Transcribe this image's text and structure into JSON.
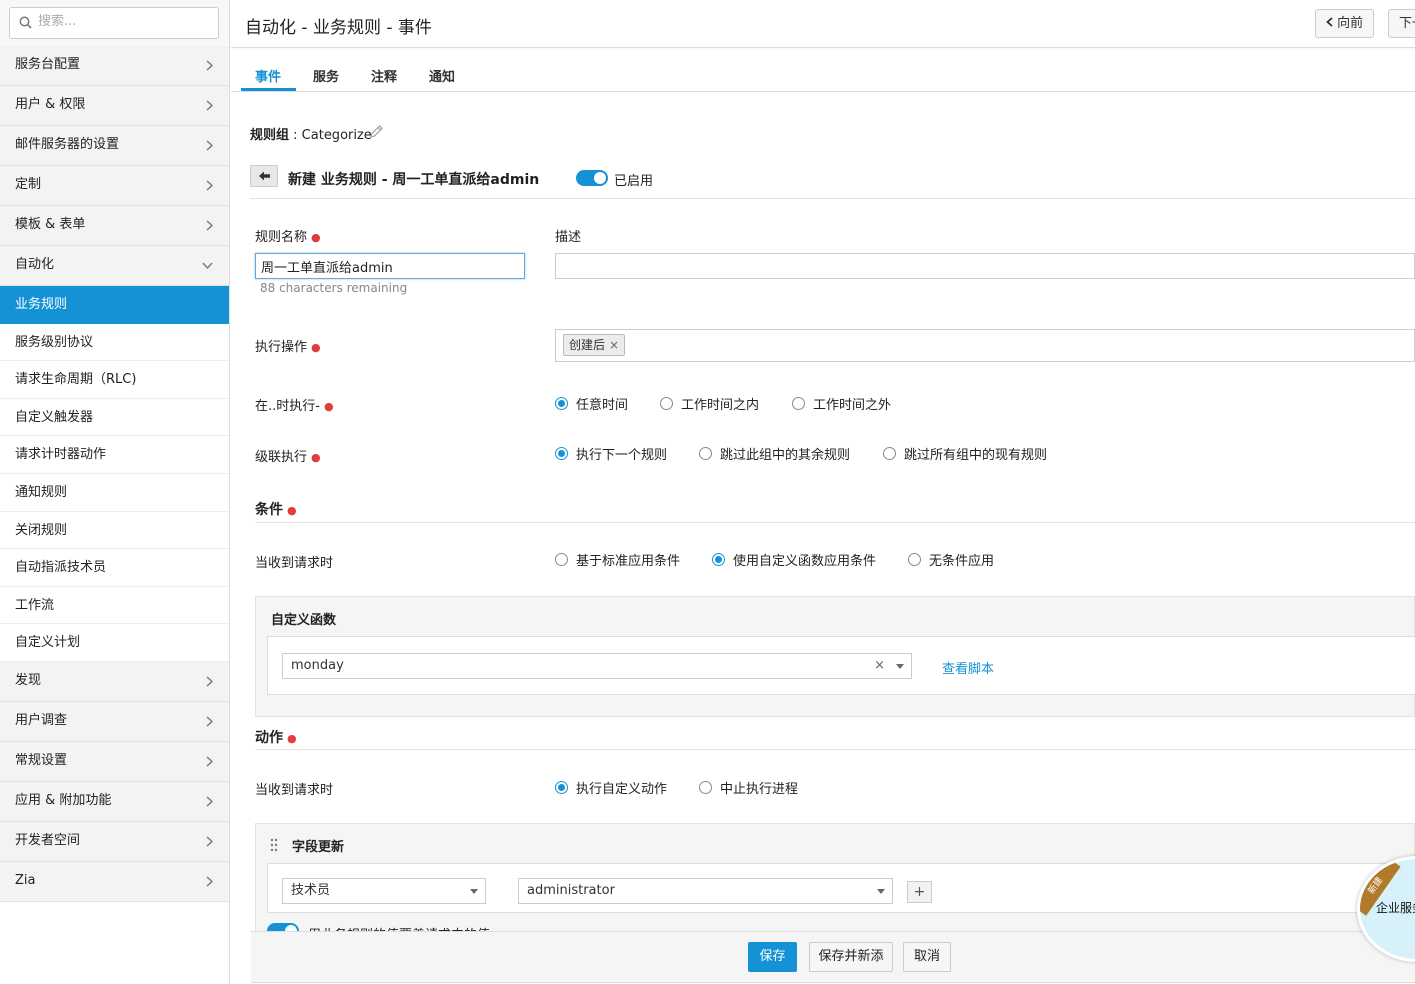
{
  "search": {
    "placeholder": "搜索..."
  },
  "sidebar": {
    "groups_top": [
      {
        "label": "服务台配置"
      },
      {
        "label": "用户 & 权限"
      },
      {
        "label": "邮件服务器的设置"
      },
      {
        "label": "定制"
      },
      {
        "label": "模板 & 表单"
      },
      {
        "label": "自动化"
      }
    ],
    "automation_items": [
      {
        "label": "业务规则",
        "active": true
      },
      {
        "label": "服务级别协议"
      },
      {
        "label": "请求生命周期（RLC)"
      },
      {
        "label": "自定义触发器"
      },
      {
        "label": "请求计时器动作"
      },
      {
        "label": "通知规则"
      },
      {
        "label": "关闭规则"
      },
      {
        "label": "自动指派技术员"
      },
      {
        "label": "工作流"
      },
      {
        "label": "自定义计划"
      }
    ],
    "groups_bottom": [
      {
        "label": "发现"
      },
      {
        "label": "用户调查"
      },
      {
        "label": "常规设置"
      },
      {
        "label": "应用 & 附加功能"
      },
      {
        "label": "开发者空间"
      },
      {
        "label": "Zia"
      }
    ]
  },
  "header": {
    "title": "自动化 - 业务规则 - 事件",
    "prev_label": "向前",
    "next_label": "下一"
  },
  "tabs": [
    "事件",
    "服务",
    "注释",
    "通知"
  ],
  "form": {
    "rule_group_label": "规则组",
    "rule_group_value": "Categorize",
    "heading": "新建 业务规则 - 周一工单直派给admin",
    "enabled_label": "已启用",
    "rule_name_label": "规则名称",
    "rule_name_value": "周一工单直派给admin",
    "chars_remaining": "88 characters remaining",
    "description_label": "描述",
    "description_value": "",
    "execute_on_label": "执行操作",
    "execute_on_tag": "创建后",
    "execute_time_label": "在..时执行-",
    "execute_time_options": [
      "任意时间",
      "工作时间之内",
      "工作时间之外"
    ],
    "execute_time_selected": 0,
    "cascade_label": "级联执行",
    "cascade_options": [
      "执行下一个规则",
      "跳过此组中的其余规则",
      "跳过所有组中的现有规则"
    ],
    "cascade_selected": 0,
    "conditions_heading": "条件",
    "conditions_when_label": "当收到请求时",
    "conditions_options": [
      "基于标准应用条件",
      "使用自定义函数应用条件",
      "无条件应用"
    ],
    "conditions_selected": 1,
    "custom_function_heading": "自定义函数",
    "custom_function_value": "monday",
    "view_script_label": "查看脚本",
    "actions_heading": "动作",
    "actions_when_label": "当收到请求时",
    "actions_options": [
      "执行自定义动作",
      "中止执行进程"
    ],
    "actions_selected": 0,
    "field_update_heading": "字段更新",
    "field_select_value": "技术员",
    "field_value_select": "administrator",
    "partial_toggle_text": "用业务规则的值覆盖请求中的值"
  },
  "footer": {
    "save_label": "保存",
    "save_new_label": "保存并新添",
    "cancel_label": "取消"
  },
  "badge": {
    "ribbon": "新建",
    "text": "企业服务"
  },
  "colors": {
    "accent": "#1592d6",
    "required": "#e23c3c",
    "badge_ribbon": "#b07a2a"
  }
}
